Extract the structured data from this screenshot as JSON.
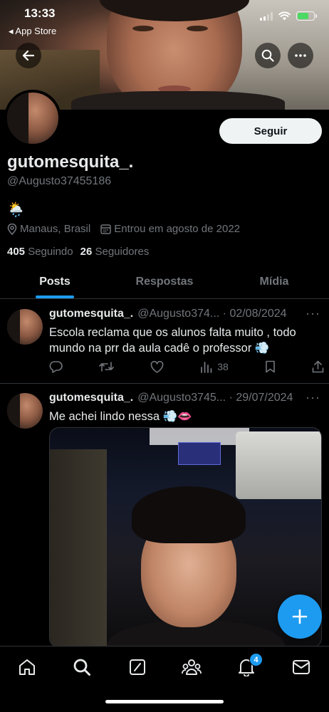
{
  "status_bar": {
    "time": "13:33",
    "back_app": "◂ App Store"
  },
  "profile": {
    "display_name": "gutomesquita_.",
    "handle": "@Augusto37455186",
    "bio_emoji": "🌦️",
    "location": "Manaus, Brasil",
    "joined": "Entrou em agosto de 2022",
    "following_count": "405",
    "following_label": "Seguindo",
    "followers_count": "26",
    "followers_label": "Seguidores",
    "follow_label": "Seguir"
  },
  "tabs": [
    {
      "label": "Posts",
      "active": true
    },
    {
      "label": "Respostas",
      "active": false
    },
    {
      "label": "Mídia",
      "active": false
    }
  ],
  "tweets": [
    {
      "name": "gutomesquita_.",
      "handle_date": "@Augusto374... · 02/08/2024",
      "text": "Escola reclama que os alunos falta muito , todo mundo na prr da aula cadê o professor 💨",
      "views": "38"
    },
    {
      "name": "gutomesquita_.",
      "handle_date": "@Augusto3745... · 29/07/2024",
      "text": "Me achei lindo nessa 💨👄"
    }
  ],
  "notifications_badge": "4",
  "colors": {
    "accent": "#1d9bf0",
    "background": "#000000",
    "text": "#e7e9ea",
    "muted": "#71767b"
  }
}
